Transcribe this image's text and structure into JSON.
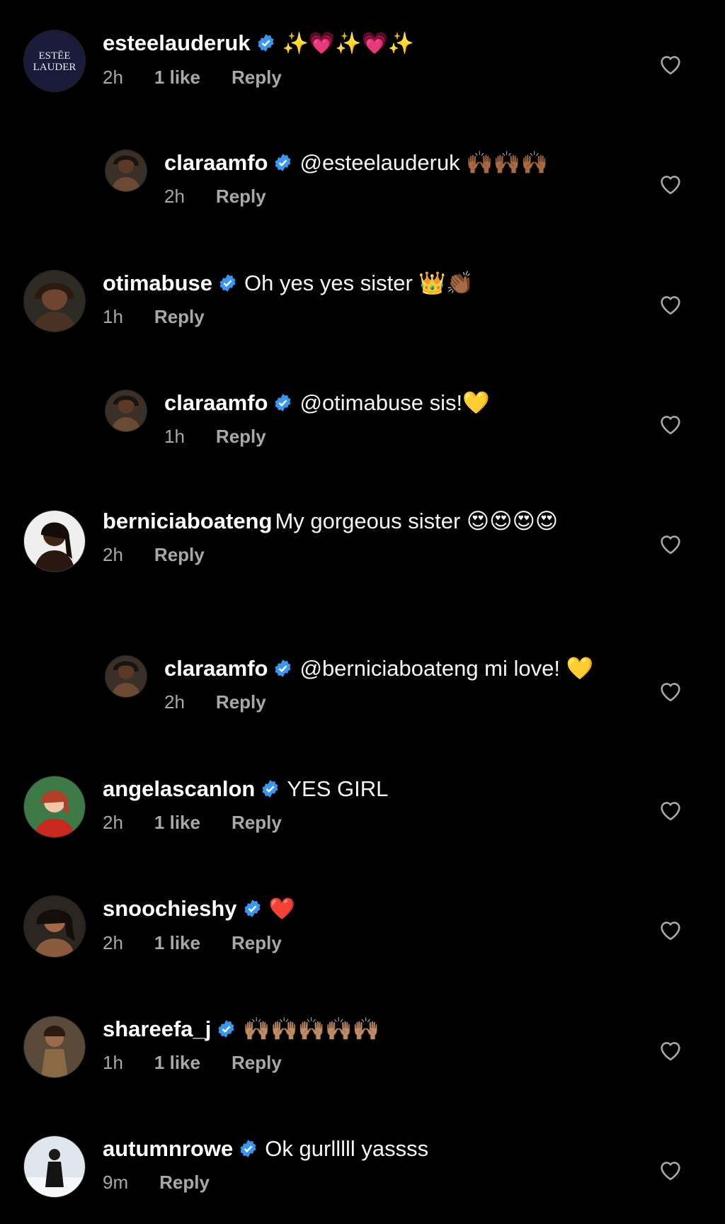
{
  "colors": {
    "background": "#000000",
    "verified_badge": "#3897f0",
    "meta_text": "#a8a8a8",
    "text": "#f5f5f5"
  },
  "icons": {
    "verified": "verified-badge-icon",
    "like": "heart-outline-icon"
  },
  "comments": [
    {
      "username": "esteelauderuk",
      "verified": true,
      "text": "✨💗✨💗✨",
      "time": "2h",
      "likes": "1 like",
      "reply": "Reply",
      "avatar_text": "ESTĒE LAUDER"
    },
    {
      "username": "claraamfo",
      "verified": true,
      "text": "@esteelauderuk 🙌🏾🙌🏾🙌🏾",
      "time": "2h",
      "likes": "",
      "reply": "Reply"
    },
    {
      "username": "otimabuse",
      "verified": true,
      "text": "Oh yes yes sister 👑👏🏾",
      "time": "1h",
      "likes": "",
      "reply": "Reply"
    },
    {
      "username": "claraamfo",
      "verified": true,
      "text": "@otimabuse  sis!💛",
      "time": "1h",
      "likes": "",
      "reply": "Reply"
    },
    {
      "username": "berniciaboateng",
      "verified": false,
      "text": "My gorgeous sister 😍😍😍😍",
      "time": "2h",
      "likes": "",
      "reply": "Reply"
    },
    {
      "username": "claraamfo",
      "verified": true,
      "text": "@berniciaboateng mi love! 💛",
      "time": "2h",
      "likes": "",
      "reply": "Reply"
    },
    {
      "username": "angelascanlon",
      "verified": true,
      "text": "YES GIRL",
      "time": "2h",
      "likes": "1 like",
      "reply": "Reply"
    },
    {
      "username": "snoochieshy",
      "verified": true,
      "text": "❤️",
      "time": "2h",
      "likes": "1 like",
      "reply": "Reply"
    },
    {
      "username": "shareefa_j",
      "verified": true,
      "text": "🙌🏽🙌🏽🙌🏽🙌🏽🙌🏽",
      "time": "1h",
      "likes": "1 like",
      "reply": "Reply"
    },
    {
      "username": "autumnrowe",
      "verified": true,
      "text": "Ok gurlllll yassss",
      "time": "9m",
      "likes": "",
      "reply": "Reply"
    }
  ]
}
